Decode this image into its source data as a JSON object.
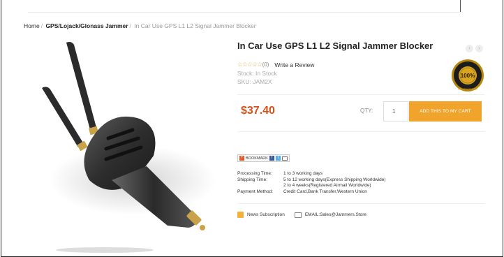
{
  "breadcrumb": {
    "home": "Home",
    "separator": "/",
    "category": "GPS/Lojack/Glonass Jammer",
    "current": "In Car Use GPS L1 L2 Signal Jammer Blocker"
  },
  "product": {
    "title": "In Car Use GPS L1 L2 Signal Jammer Blocker",
    "stars": "☆☆☆☆☆",
    "rating_count": "(0)",
    "review_link": "Write a Review",
    "stock": "Stock: In Stock",
    "sku": "SKU: JAM2X",
    "price": "$37.40",
    "qty_label": "QTY:",
    "qty_value": "1",
    "add_to_cart": "ADD THIS TO MY CART",
    "badge": {
      "text": "100%",
      "ring_text": "GUARANTEED"
    }
  },
  "share": {
    "bookmark_label": "BOOKMARK"
  },
  "info": {
    "processing_label": "Processing Time:",
    "processing_value": "1 to 3 working days",
    "shipping_label": "Shipping Time:",
    "shipping_value_1": "5 to 12 working days(Express Shipping Worldwide)",
    "shipping_value_2": "2 to 4 weeks(Registered Airmail Worldwide)",
    "payment_label": "Payment Method:",
    "payment_value": "Credit Card,Bank Transfer,Western Union"
  },
  "footer": {
    "news": "News Subscription",
    "email": "EMAIL:Sales@Jammers.Store"
  },
  "colors": {
    "accent": "#f0a42c",
    "price": "#d94f16"
  }
}
